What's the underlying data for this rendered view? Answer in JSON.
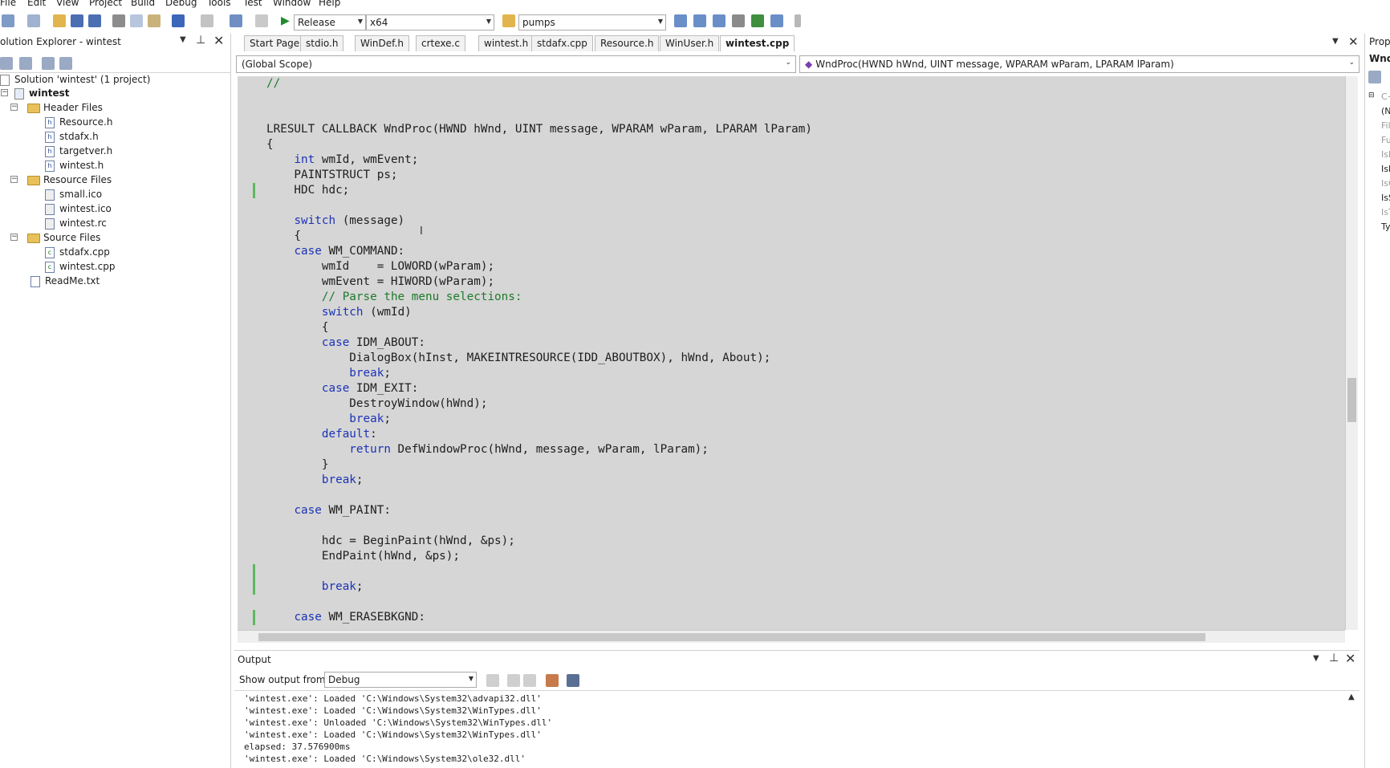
{
  "menu": [
    "File",
    "Edit",
    "View",
    "Project",
    "Build",
    "Debug",
    "Tools",
    "Test",
    "Window",
    "Help"
  ],
  "toolbar": {
    "config": "Release",
    "platform": "x64",
    "find": "pumps"
  },
  "solution_explorer": {
    "title": "olution Explorer - wintest",
    "solution": "Solution 'wintest' (1 project)",
    "project": "wintest",
    "folders": [
      {
        "name": "Header Files",
        "files": [
          "Resource.h",
          "stdafx.h",
          "targetver.h",
          "wintest.h"
        ]
      },
      {
        "name": "Resource Files",
        "files": [
          "small.ico",
          "wintest.ico",
          "wintest.rc"
        ]
      },
      {
        "name": "Source Files",
        "files": [
          "stdafx.cpp",
          "wintest.cpp"
        ]
      }
    ],
    "readme": "ReadMe.txt"
  },
  "tabs": [
    "Start Page",
    "stdio.h",
    "WinDef.h",
    "crtexe.c",
    "wintest.h",
    "stdafx.cpp",
    "Resource.h",
    "WinUser.h",
    "wintest.cpp"
  ],
  "nav": {
    "scope": "(Global Scope)",
    "member": "WndProc(HWND hWnd, UINT message, WPARAM wParam, LPARAM lParam)"
  },
  "code": [
    "//",
    "",
    "",
    "LRESULT CALLBACK WndProc(HWND hWnd, UINT message, WPARAM wParam, LPARAM lParam)",
    "{",
    "    int wmId, wmEvent;",
    "    PAINTSTRUCT ps;",
    "    HDC hdc;",
    "",
    "    switch (message)",
    "    {",
    "    case WM_COMMAND:",
    "        wmId    = LOWORD(wParam);",
    "        wmEvent = HIWORD(wParam);",
    "        // Parse the menu selections:",
    "        switch (wmId)",
    "        {",
    "        case IDM_ABOUT:",
    "            DialogBox(hInst, MAKEINTRESOURCE(IDD_ABOUTBOX), hWnd, About);",
    "            break;",
    "        case IDM_EXIT:",
    "            DestroyWindow(hWnd);",
    "            break;",
    "        default:",
    "            return DefWindowProc(hWnd, message, wParam, lParam);",
    "        }",
    "        break;",
    "",
    "    case WM_PAINT:",
    "",
    "        hdc = BeginPaint(hWnd, &ps);",
    "        EndPaint(hWnd, &ps);",
    "",
    "        break;",
    "",
    "    case WM_ERASEBKGND:"
  ],
  "output": {
    "title": "Output",
    "show_from_label": "Show output from:",
    "source": "Debug",
    "lines": [
      "'wintest.exe': Loaded 'C:\\Windows\\System32\\advapi32.dll'",
      "'wintest.exe': Loaded 'C:\\Windows\\System32\\WinTypes.dll'",
      "'wintest.exe': Unloaded 'C:\\Windows\\System32\\WinTypes.dll'",
      "'wintest.exe': Loaded 'C:\\Windows\\System32\\WinTypes.dll'",
      "elapsed: 37.576900ms",
      "'wintest.exe': Loaded 'C:\\Windows\\System32\\ole32.dll'"
    ]
  },
  "properties": {
    "title": "Prop",
    "header": "Wnd",
    "rows": [
      "C+",
      "(N",
      "Fil",
      "Fu",
      "Isl",
      "Isl",
      "IsC",
      "IsS",
      "IsT",
      "Ty"
    ]
  },
  "colors": {
    "keyword": "#1c33b5",
    "comment": "#1e7a2a",
    "editor_bg": "#d6d6d6",
    "change_marker": "#5fb85f"
  }
}
